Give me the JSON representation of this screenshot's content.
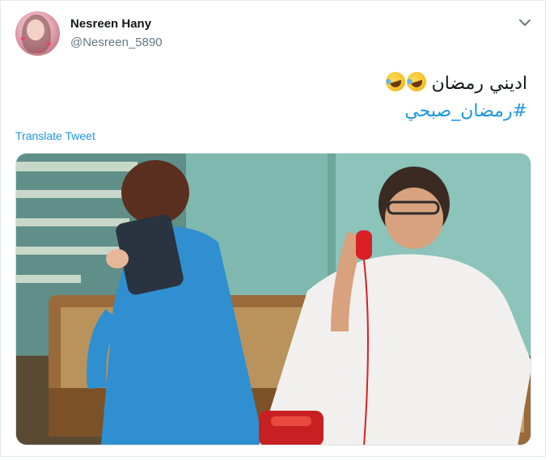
{
  "tweet": {
    "author": {
      "display_name": "Nesreen Hany",
      "handle": "@Nesreen_5890"
    },
    "text": "اديني رمضان",
    "emoji_names": [
      "rolling-on-the-floor-laughing",
      "rolling-on-the-floor-laughing"
    ],
    "hashtag": "#رمضان_صبحي",
    "translate_label": "Translate Tweet",
    "media": {
      "description_icon": "photo",
      "scene_colors": {
        "wall": "#7fb8ae",
        "sofa": "#9a6a3a",
        "blue_dress": "#2f8fd0",
        "white_robe": "#f2f0ee",
        "phone": "#d91f24"
      }
    }
  },
  "colors": {
    "link": "#1b95e0",
    "text": "#14171a",
    "secondary": "#657786",
    "border": "#e1e8ed"
  },
  "icons": {
    "menu_caret": "chevron-down-icon"
  }
}
